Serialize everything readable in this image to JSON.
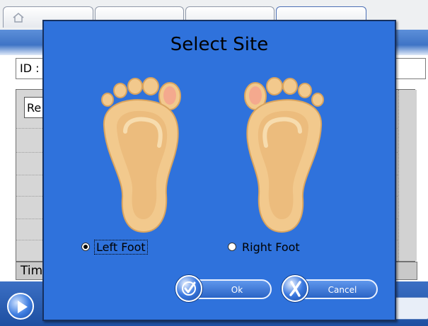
{
  "background_app": {
    "id_label": "ID :",
    "grid_select_text": "Re",
    "time_label": "Tim",
    "home_icon": "home-icon",
    "play_icon": "play-icon"
  },
  "dialog": {
    "title": "Select Site",
    "options": [
      {
        "label": "Left Foot",
        "selected": true
      },
      {
        "label": "Right Foot",
        "selected": false
      }
    ],
    "ok_label": "Ok",
    "cancel_label": "Cancel",
    "ok_icon": "checkmark-icon",
    "cancel_icon": "x-icon"
  },
  "colors": {
    "dialog_background": "#2f72dc",
    "foot_fill": "#f2c98d",
    "foot_shade": "#d9a45f",
    "toe_highlight": "#f4a98e"
  }
}
